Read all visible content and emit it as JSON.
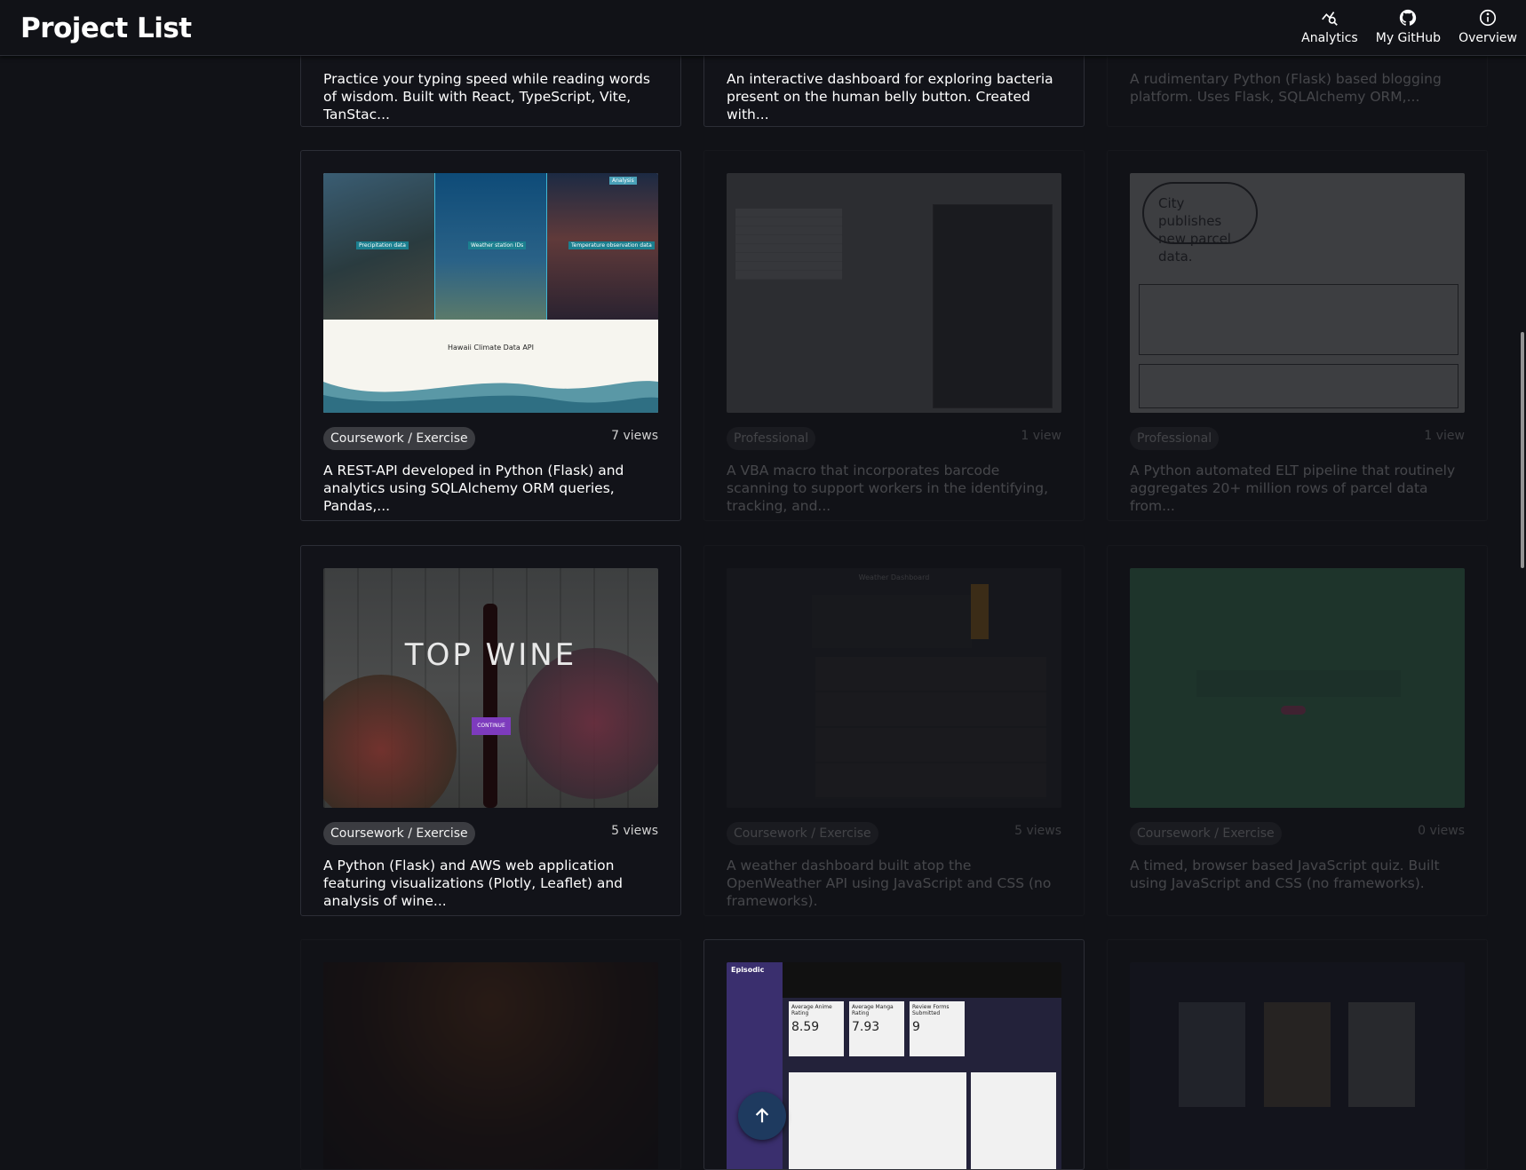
{
  "header": {
    "title": "Project List",
    "nav": [
      {
        "label": "Analytics",
        "icon": "analytics-icon"
      },
      {
        "label": "My GitHub",
        "icon": "github-icon"
      },
      {
        "label": "Overview",
        "icon": "info-icon"
      }
    ]
  },
  "cards": [
    {
      "category": "",
      "views": "",
      "description": "Practice your typing speed while reading words of wisdom. Built with React, TypeScript, Vite, TanStac...",
      "thumb": ""
    },
    {
      "category": "",
      "views": "",
      "description": "An interactive dashboard for exploring bacteria present on the human belly button. Created with...",
      "thumb": ""
    },
    {
      "category": "",
      "views": "",
      "description": "A rudimentary Python (Flask) based blogging platform. Uses Flask, SQLAlchemy ORM,...",
      "thumb": ""
    },
    {
      "category": "Coursework / Exercise",
      "views": "7 views",
      "description": "A REST-API developed in Python (Flask) and analytics using SQLAlchemy ORM queries, Pandas,...",
      "thumb_title": "Hawaii Climate Data API",
      "thumb_labels": [
        "Precipitation data",
        "Weather station IDs",
        "Temperature observation data",
        "Analysis"
      ]
    },
    {
      "category": "Professional",
      "views": "1 view",
      "description": "A VBA macro that incorporates barcode scanning to support workers in the identifying, tracking, and..."
    },
    {
      "category": "Professional",
      "views": "1 view",
      "description": "A Python automated ELT pipeline that routinely aggregates 20+ million rows of parcel data from...",
      "thumb_title": "City publishes new parcel data."
    },
    {
      "category": "Coursework / Exercise",
      "views": "5 views",
      "description": "A Python (Flask) and AWS web application featuring visualizations (Plotly, Leaflet) and analysis of wine...",
      "thumb_title": "TOP WINE",
      "thumb_button": "CONTINUE"
    },
    {
      "category": "Coursework / Exercise",
      "views": "5 views",
      "description": "A weather dashboard built atop the OpenWeather API using JavaScript and CSS (no frameworks).",
      "thumb_title": "Weather Dashboard"
    },
    {
      "category": "Coursework / Exercise",
      "views": "0 views",
      "description": "A timed, browser based JavaScript quiz. Built using JavaScript and CSS (no frameworks)."
    },
    {
      "category": "",
      "views": "",
      "description": ""
    },
    {
      "category": "",
      "views": "",
      "description": "",
      "thumb_title": "Episodic",
      "thumb_metrics": [
        "Average Anime Rating",
        "8.59",
        "Average Manga Rating",
        "7.93",
        "Review Forms Submitted",
        "9"
      ]
    },
    {
      "category": "",
      "views": "",
      "description": ""
    }
  ],
  "colors": {
    "background": "#111217",
    "chip": "#3b3c41",
    "accent": "#1e3a5f"
  }
}
